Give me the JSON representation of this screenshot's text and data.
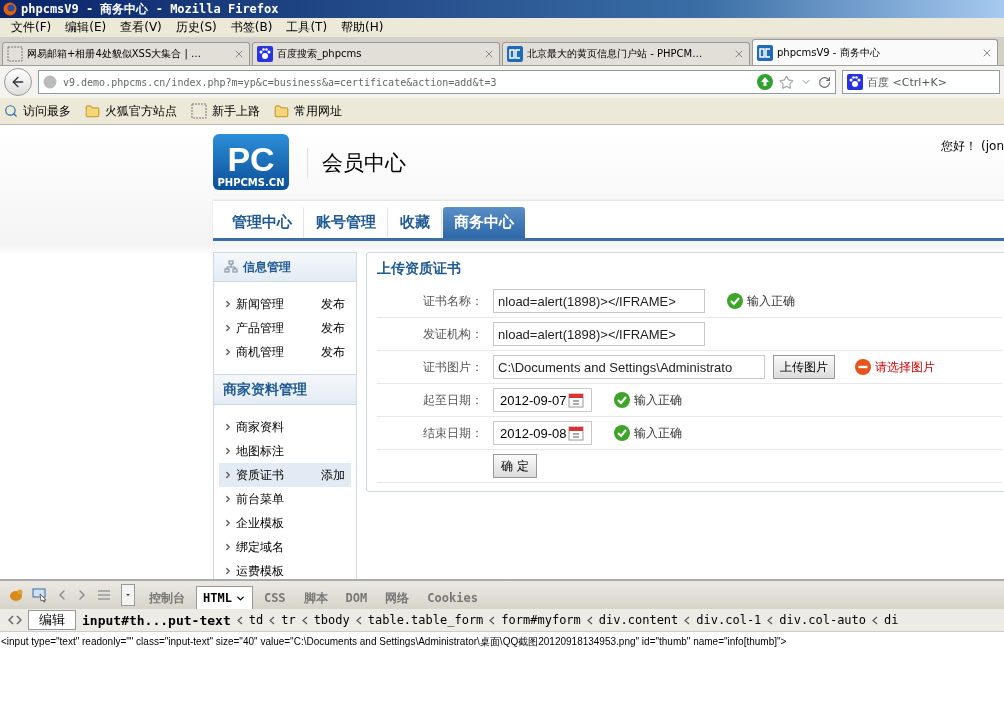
{
  "window": {
    "title": "phpcmsV9 - 商务中心 - Mozilla Firefox"
  },
  "menu": [
    "文件(F)",
    "编辑(E)",
    "查看(V)",
    "历史(S)",
    "书签(B)",
    "工具(T)",
    "帮助(H)"
  ],
  "tabs": [
    {
      "label": "网易邮箱+相册4处貌似XSS大集合 | …",
      "kind": "blank",
      "selected": false
    },
    {
      "label": "百度搜索_phpcms",
      "kind": "paw",
      "selected": false
    },
    {
      "label": "北京最大的黄页信息门户站 - PHPCM…",
      "kind": "pc",
      "selected": false
    },
    {
      "label": "phpcmsV9 - 商务中心",
      "kind": "pc",
      "selected": true
    }
  ],
  "address": {
    "value": "v9.demo.phpcms.cn/index.php?m=yp&c=business&a=certificate&action=add&t=3"
  },
  "search": {
    "placeholder": "百度 <Ctrl+K>"
  },
  "bookmarks": [
    {
      "label": "访问最多",
      "kind": "search"
    },
    {
      "label": "火狐官方站点",
      "kind": "folder"
    },
    {
      "label": "新手上路",
      "kind": "blank"
    },
    {
      "label": "常用网址",
      "kind": "folder"
    }
  ],
  "page": {
    "logo": {
      "mark": "PC",
      "caption": "PHPCMS.CN"
    },
    "site_title": "会员中心",
    "greeting": "您好！ (jon",
    "nav": [
      {
        "label": "管理中心",
        "selected": false
      },
      {
        "label": "账号管理",
        "selected": false
      },
      {
        "label": "收藏",
        "selected": false
      },
      {
        "label": "商务中心",
        "selected": true
      }
    ],
    "sidebar": [
      {
        "title": "信息管理",
        "kind": "icon",
        "items": [
          {
            "label": "新闻管理",
            "action": "发布",
            "selected": false
          },
          {
            "label": "产品管理",
            "action": "发布",
            "selected": false
          },
          {
            "label": "商机管理",
            "action": "发布",
            "selected": false
          }
        ]
      },
      {
        "title": "商家资料管理",
        "kind": "large",
        "items": [
          {
            "label": "商家资料",
            "selected": false
          },
          {
            "label": "地图标注",
            "selected": false
          },
          {
            "label": "资质证书",
            "action": "添加",
            "selected": true
          },
          {
            "label": "前台菜单",
            "selected": false
          },
          {
            "label": "企业模板",
            "selected": false
          },
          {
            "label": "绑定域名",
            "selected": false
          },
          {
            "label": "运费模板",
            "selected": false
          }
        ]
      }
    ],
    "form": {
      "title": "上传资质证书",
      "rows": [
        {
          "label": "证书名称：",
          "kind": "text",
          "value": "nload=alert(1898)></IFRAME>",
          "status": {
            "kind": "ok",
            "text": "输入正确"
          }
        },
        {
          "label": "发证机构：",
          "kind": "text",
          "value": "nload=alert(1898)></IFRAME>"
        },
        {
          "label": "证书图片：",
          "kind": "file",
          "value": "C:\\Documents and Settings\\Administrato",
          "button": "上传图片",
          "status": {
            "kind": "error",
            "text": "请选择图片"
          }
        },
        {
          "label": "起至日期：",
          "kind": "date",
          "value": "2012-09-07",
          "status": {
            "kind": "ok",
            "text": "输入正确"
          }
        },
        {
          "label": "结束日期：",
          "kind": "date",
          "value": "2012-09-08",
          "status": {
            "kind": "ok",
            "text": "输入正确"
          }
        }
      ],
      "submit": "确 定"
    }
  },
  "devtools": {
    "panels": [
      {
        "label": "控制台",
        "selected": false
      },
      {
        "label": "HTML",
        "selected": true
      },
      {
        "label": "CSS",
        "selected": false
      },
      {
        "label": "脚本",
        "selected": false
      },
      {
        "label": "DOM",
        "selected": false
      },
      {
        "label": "网络",
        "selected": false
      },
      {
        "label": "Cookies",
        "selected": false
      }
    ],
    "edit_button": "编辑",
    "breadcrumb": [
      "input#th...put-text",
      "td",
      "tr",
      "tbody",
      "table.table_form",
      "form#myform",
      "div.content",
      "div.col-1",
      "div.col-auto",
      "di"
    ],
    "source": "<input type=\"text\" readonly=\"\" class=\"input-text\" size=\"40\" value=\"C:\\Documents and Settings\\Administrator\\桌面\\QQ截图20120918134953.png\" id=\"thumb\" name=\"info[thumb]\">"
  }
}
